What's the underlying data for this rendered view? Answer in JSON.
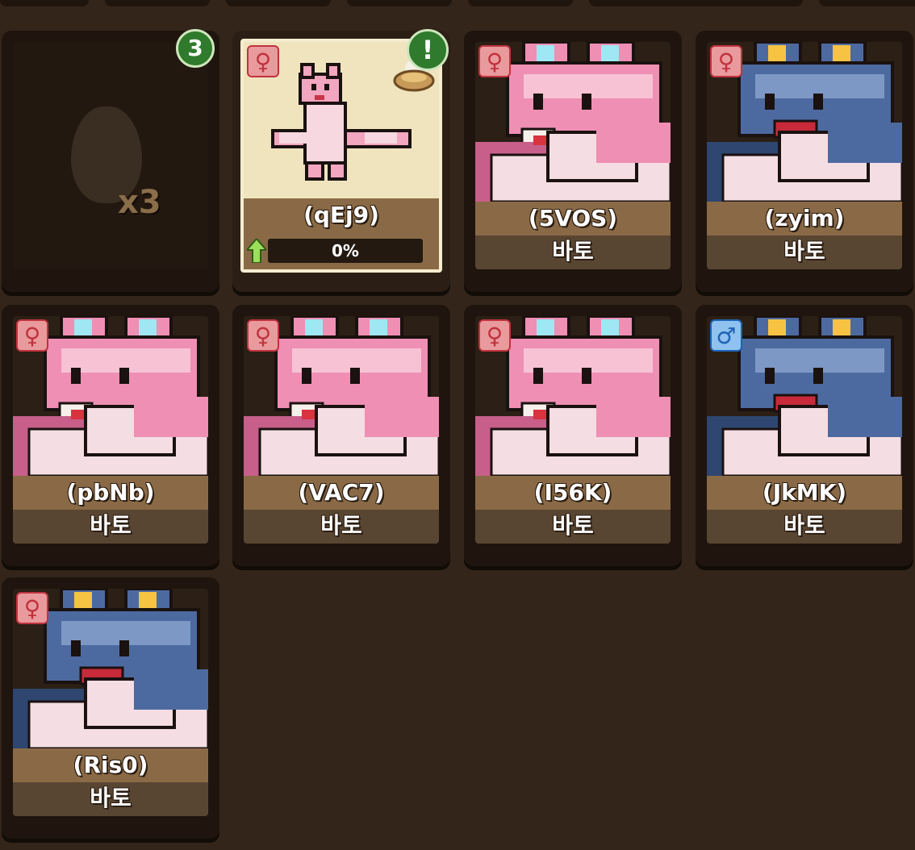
{
  "egg_card": {
    "count": "x3",
    "badge": "3"
  },
  "hatching_card": {
    "name": "(qEj9)",
    "badge": "!",
    "progress_label": "0%",
    "progress": 0,
    "gender": "female"
  },
  "cards": [
    {
      "name": "(5VOS)",
      "species": "바토",
      "gender": "female",
      "variant": "pink"
    },
    {
      "name": "(zyim)",
      "species": "바토",
      "gender": "female",
      "variant": "blue"
    },
    {
      "name": "(pbNb)",
      "species": "바토",
      "gender": "female",
      "variant": "pink"
    },
    {
      "name": "(VAC7)",
      "species": "바토",
      "gender": "female",
      "variant": "pink"
    },
    {
      "name": "(I56K)",
      "species": "바토",
      "gender": "female",
      "variant": "pink"
    },
    {
      "name": "(JkMK)",
      "species": "바토",
      "gender": "male",
      "variant": "blue"
    },
    {
      "name": "(Ris0)",
      "species": "바토",
      "gender": "female",
      "variant": "blue"
    }
  ],
  "gender_symbols": {
    "female": "♀",
    "male": "♂"
  },
  "colors": {
    "pink_body": "#ef8fb3",
    "blue_body": "#4d6aa0",
    "badge_green": "#2f7a2c",
    "progress_green": "#7cc043"
  },
  "icons": {
    "gender_female": "female-icon",
    "gender_male": "male-icon",
    "notification": "alert-badge",
    "egg": "egg-icon",
    "nest": "nest-icon",
    "progress": "up-arrow-icon"
  }
}
